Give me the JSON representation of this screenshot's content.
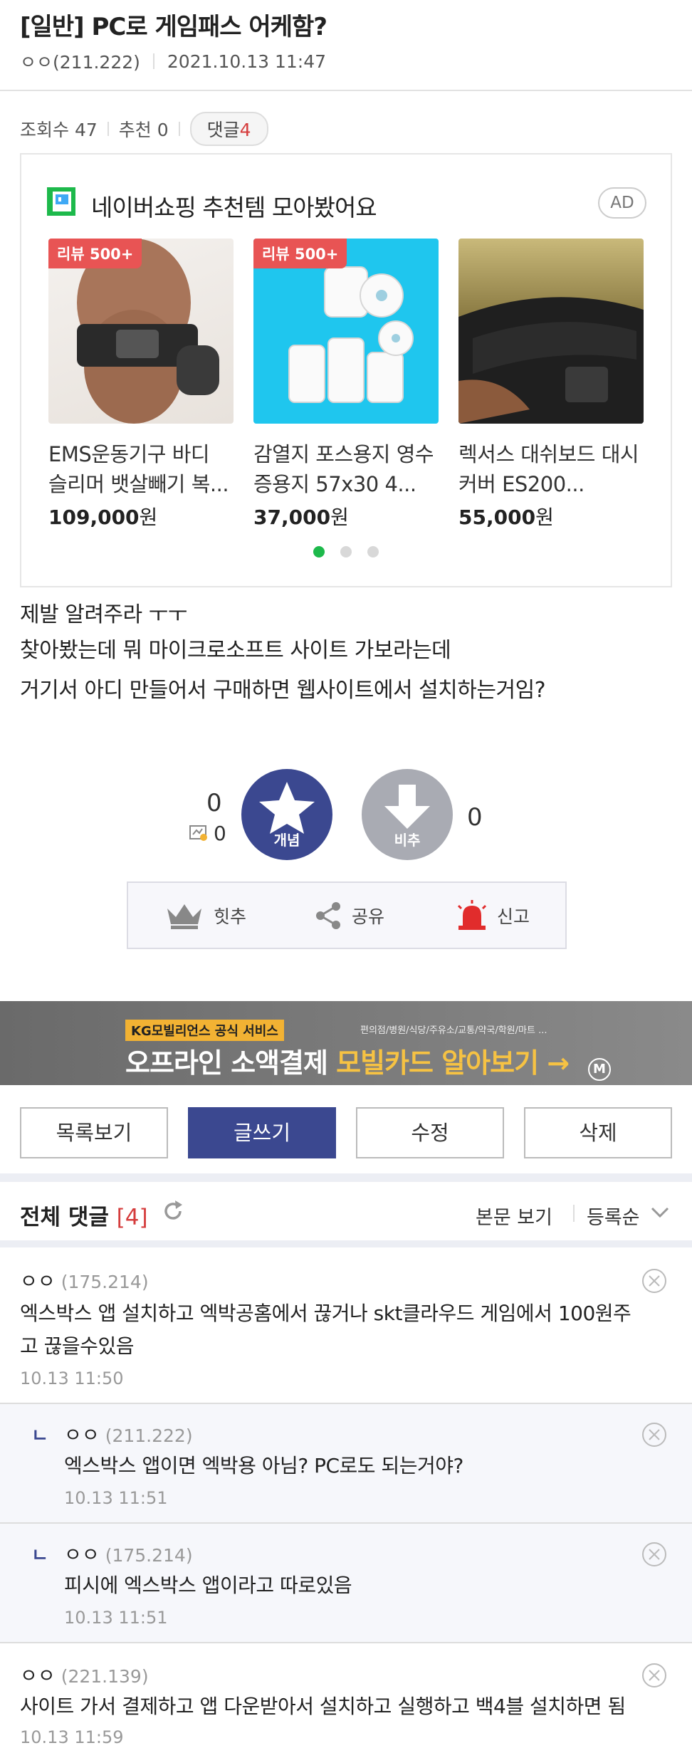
{
  "post": {
    "title": "[일반] PC로 게임패스 어케함?",
    "author": "ㅇㅇ(211.222)",
    "date": "2021.10.13 11:47",
    "views_label": "조회수 47",
    "recommend_label": "추천 0",
    "comments_label": "댓글",
    "comments_count": "4",
    "body": [
      "제발 알려주라 ㅜㅜ",
      "찾아봤는데 뭐 마이크로소프트 사이트 가보라는데",
      "거기서 아디 만들어서 구매하면 웹사이트에서 설치하는거임?"
    ]
  },
  "ad": {
    "heading": "네이버쇼핑 추천템 모아봤어요",
    "badge": "AD",
    "products": [
      {
        "badge": "리뷰 500+",
        "name": "EMS운동기구 바디 슬리머 뱃살빼기 복...",
        "price": "109,000",
        "won": "원"
      },
      {
        "badge": "리뷰 500+",
        "name": "감열지 포스용지 영수증용지 57x30 4...",
        "price": "37,000",
        "won": "원"
      },
      {
        "badge": "",
        "name": "렉서스 대쉬보드 대시 커버 ES200...",
        "price": "55,000",
        "won": "원"
      }
    ]
  },
  "vote": {
    "up_count": "0",
    "mini_count": "0",
    "up_label": "개념",
    "down_label": "비추",
    "down_count": "0",
    "actions": [
      "힛추",
      "공유",
      "신고"
    ]
  },
  "banner": {
    "tag": "KG모빌리언스 공식 서비스",
    "main_a": "오프라인 소액결제 ",
    "main_b": "모빌카드 알아보기 →",
    "sub": "편의점/병원/식당/주유소/교통/약국/학원/마트 ...",
    "m": "M"
  },
  "buttons": [
    "목록보기",
    "글쓰기",
    "수정",
    "삭제"
  ],
  "comments_header": {
    "title": "전체 댓글",
    "count": "[4]",
    "view_body": "본문 보기",
    "sort": "등록순"
  },
  "comments": [
    {
      "nick": "ㅇㅇ",
      "ip": "(175.214)",
      "text": [
        "엑스박스 앱 설치하고 엑박공홈에서 끊거나 skt클라우드 게임에서 100원주",
        "고 끊을수있음"
      ],
      "date": "10.13 11:50"
    },
    {
      "nick": "ㅇㅇ",
      "ip": "(211.222)",
      "text": [
        "엑스박스 앱이면 엑박용 아님? PC로도 되는거야?"
      ],
      "date": "10.13 11:51"
    },
    {
      "nick": "ㅇㅇ",
      "ip": "(175.214)",
      "text": [
        "피시에 엑스박스 앱이라고 따로있음"
      ],
      "date": "10.13 11:51"
    },
    {
      "nick": "ㅇㅇ",
      "ip": "(221.139)",
      "text": [
        "사이트 가서 결제하고 앱 다운받아서 설치하고 실행하고 백4블 설치하면 됨"
      ],
      "date": "10.13 11:59"
    }
  ],
  "reply_mark": "ㄴ"
}
